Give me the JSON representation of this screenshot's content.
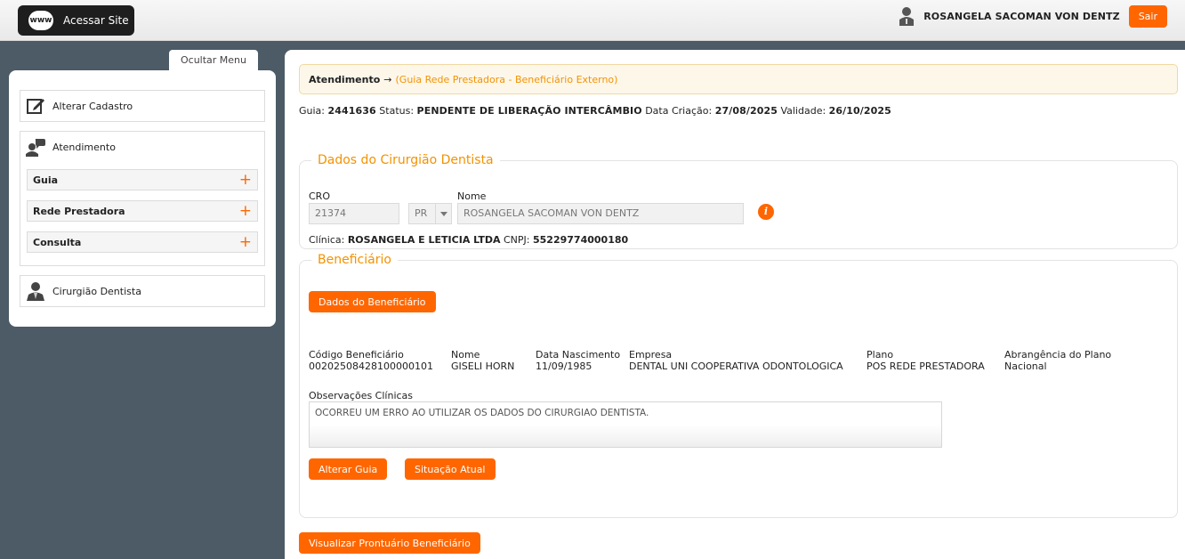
{
  "topbar": {
    "site_icon": "www-globe-icon",
    "site_icon_text": "www",
    "site_label": "Acessar Site",
    "user_name": "ROSANGELA SACOMAN VON DENTZ",
    "logout_label": "Sair"
  },
  "sidebar": {
    "toggle_label": "Ocultar Menu",
    "alterar_cadastro": "Alterar Cadastro",
    "atendimento": "Atendimento",
    "sub_items": [
      {
        "label": "Guia",
        "icon": "+"
      },
      {
        "label": "Rede Prestadora",
        "icon": "+"
      },
      {
        "label": "Consulta",
        "icon": "+"
      }
    ],
    "cirurgiao": "Cirurgião Dentista"
  },
  "breadcrumb": {
    "title": "Atendimento",
    "arrow": "→",
    "subtitle": "(Guia Rede Prestadora - Beneficiário Externo)"
  },
  "guia": {
    "guia_label": "Guia:",
    "guia_value": "2441636",
    "status_label": "Status:",
    "status_value": "PENDENTE DE LIBERAÇÃO INTERCÂMBIO",
    "criacao_label": "Data Criação:",
    "criacao_value": "27/08/2025",
    "validade_label": "Validade:",
    "validade_value": "26/10/2025"
  },
  "dentista": {
    "legend": "Dados do Cirurgião Dentista",
    "cro_label": "CRO",
    "cro_value": "21374",
    "uf_value": "PR",
    "nome_label": "Nome",
    "nome_value": "ROSANGELA SACOMAN VON DENTZ",
    "info_icon": "i",
    "clinica_label": "Clínica:",
    "clinica_value": "ROSANGELA E LETICIA LTDA",
    "cnpj_label": "CNPJ:",
    "cnpj_value": "55229774000180"
  },
  "beneficiario": {
    "legend": "Beneficiário",
    "dados_button": "Dados do Beneficiário",
    "columns": [
      {
        "label": "Código Beneficiário",
        "value": "00202508428100000101"
      },
      {
        "label": "Nome",
        "value": "GISELI HORN"
      },
      {
        "label": "Data Nascimento",
        "value": "11/09/1985"
      },
      {
        "label": "Empresa",
        "value": "DENTAL UNI COOPERATIVA ODONTOLOGICA"
      },
      {
        "label": "Plano",
        "value": "POS REDE PRESTADORA"
      },
      {
        "label": "Abrangência do Plano",
        "value": "Nacional"
      }
    ],
    "obs_label": "Observações Clínicas",
    "obs_value": "OCORREU UM ERRO AO UTILIZAR OS DADOS DO CIRURGIAO DENTISTA.",
    "alterar_button": "Alterar Guia",
    "situacao_button": "Situação Atual"
  },
  "footer_button": "Visualizar Prontuário Beneficiário",
  "colors": {
    "accent": "#ff6600",
    "legend": "#f39200",
    "sidebar_bg": "#4c5b66"
  }
}
